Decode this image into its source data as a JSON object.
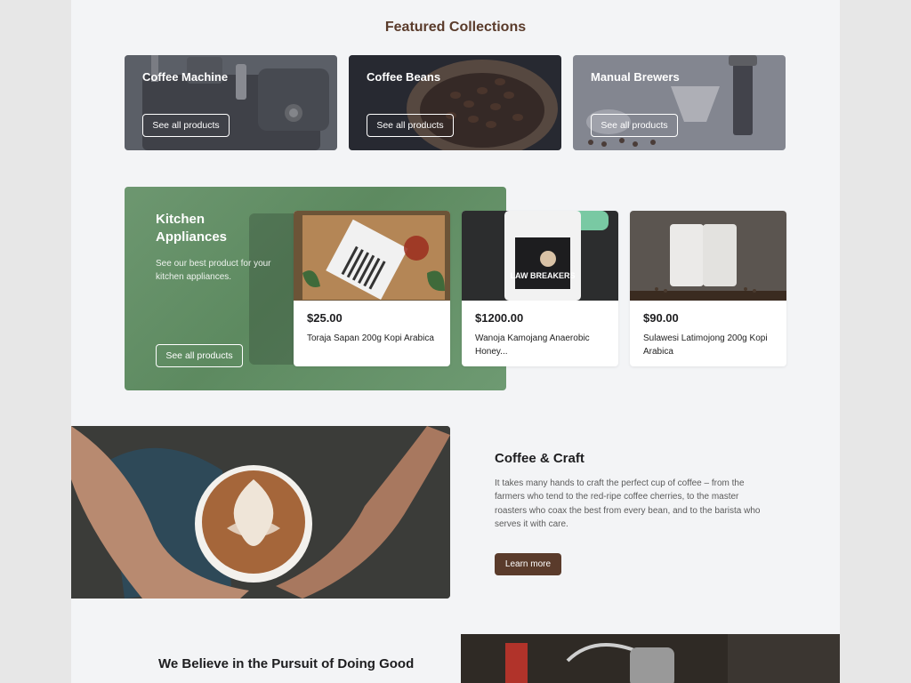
{
  "featured": {
    "title": "Featured Collections",
    "collections": [
      {
        "title": "Coffee Machine",
        "button": "See all products"
      },
      {
        "title": "Coffee Beans",
        "button": "See all products"
      },
      {
        "title": "Manual Brewers",
        "button": "See all products"
      }
    ]
  },
  "kitchen": {
    "title": "Kitchen Appliances",
    "description": "See our best product for your kitchen appliances.",
    "button": "See all products"
  },
  "products": [
    {
      "price": "$25.00",
      "name": "Toraja Sapan 200g Kopi Arabica"
    },
    {
      "price": "$1200.00",
      "name": "Wanoja Kamojang Anaerobic Honey..."
    },
    {
      "price": "$90.00",
      "name": "Sulawesi Latimojong 200g Kopi Arabica"
    }
  ],
  "craft": {
    "title": "Coffee & Craft",
    "body": "It takes many hands to craft the perfect cup of coffee – from the farmers who tend to the red-ripe coffee cherries, to the master roasters who coax the best from every bean, and to the barista who serves it with care.",
    "button": "Learn more"
  },
  "believe": {
    "title": "We Believe in the Pursuit of Doing Good"
  },
  "product_labels": {
    "law_breakers": "LAW BREAKERS"
  },
  "colors": {
    "accent": "#5a3b2b",
    "page_bg": "#f3f4f6",
    "kitchen_bg": "#6a946d"
  }
}
